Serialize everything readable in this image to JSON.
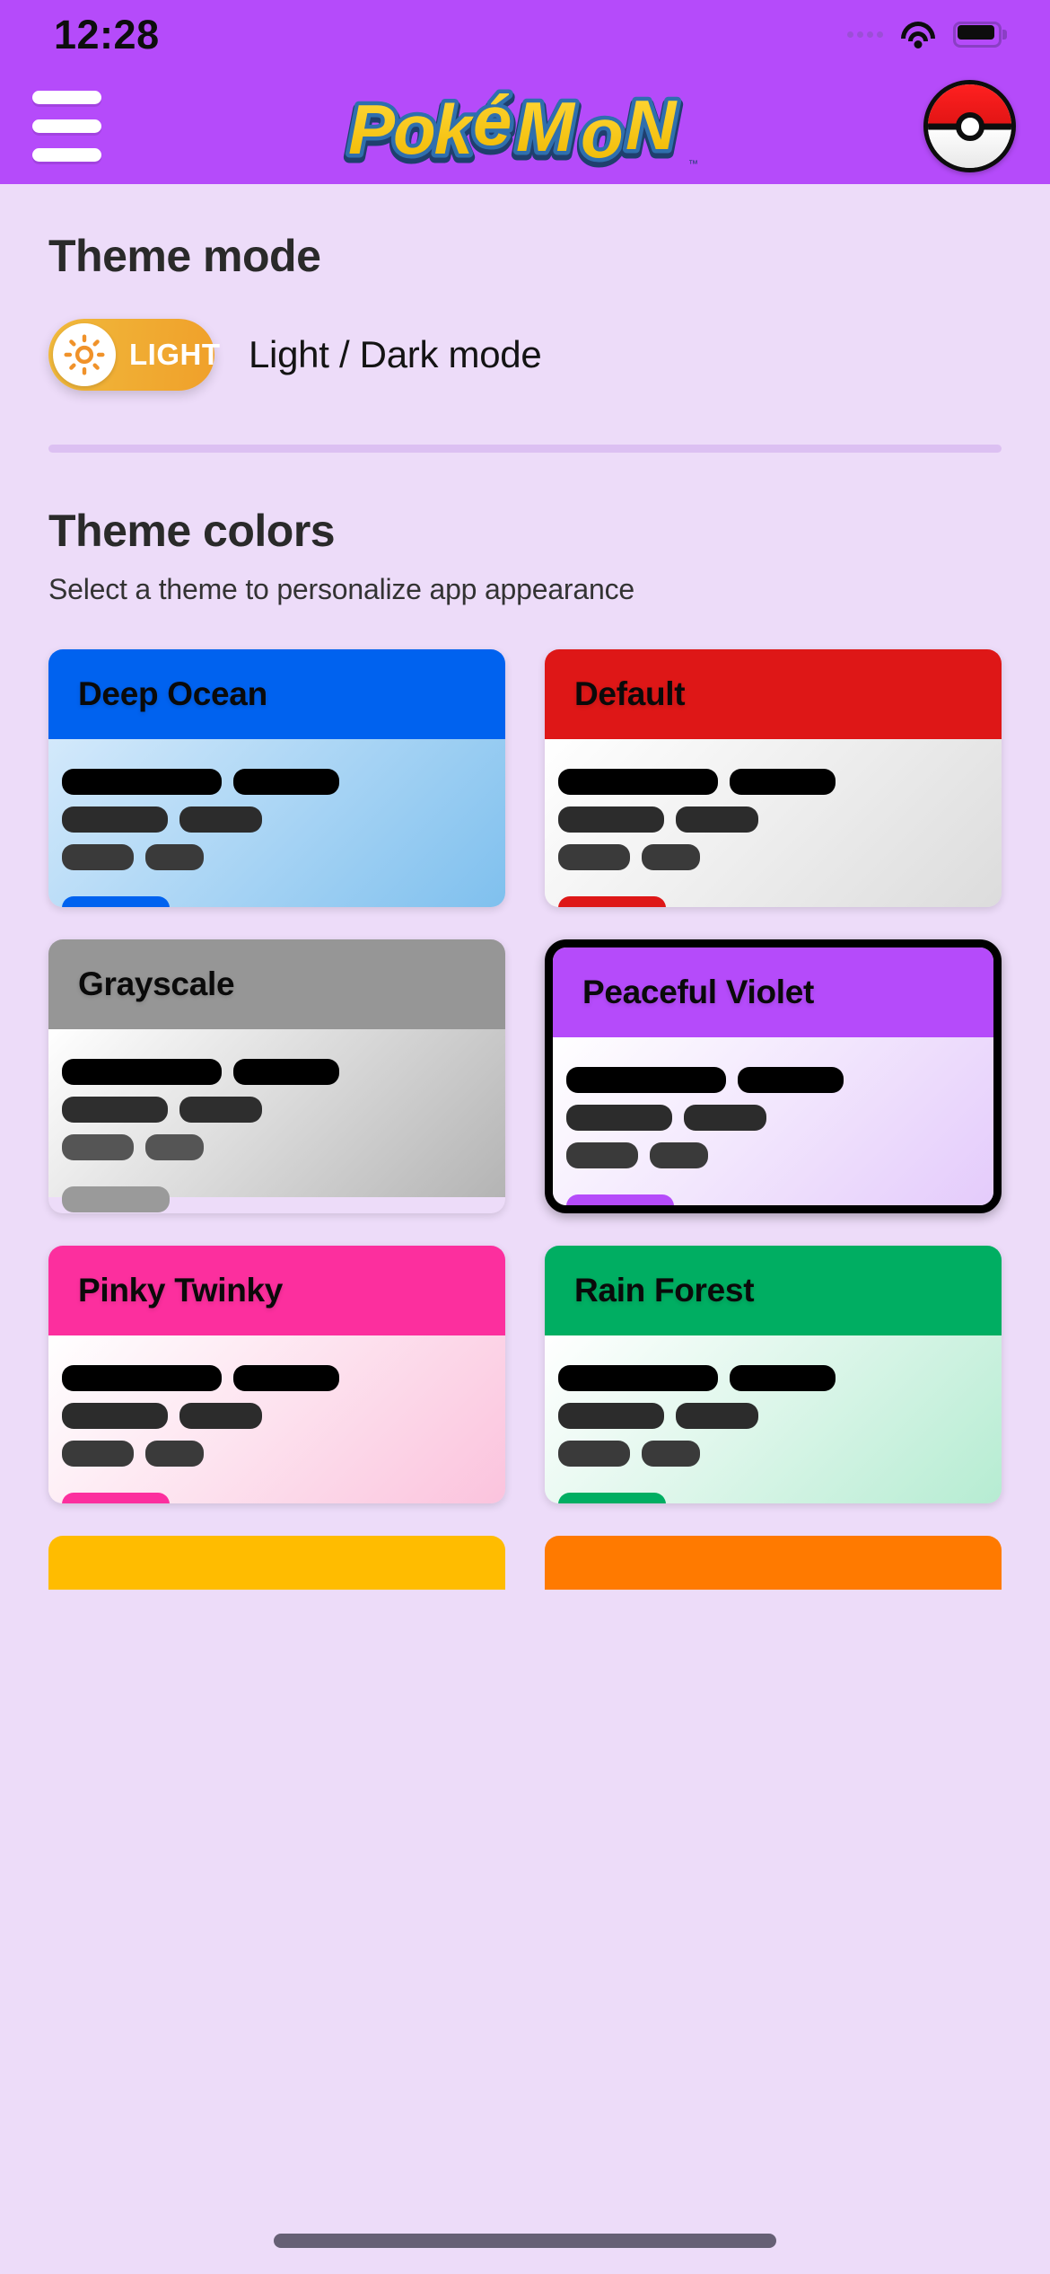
{
  "status_bar": {
    "time": "12:28",
    "icons": [
      "signal-dots-icon",
      "wifi-icon",
      "battery-icon"
    ]
  },
  "header": {
    "menu_icon": "hamburger-menu-icon",
    "logo_text": "Pokémon",
    "logo_tm": "TM",
    "profile_icon": "pokeball-icon",
    "background_color": "#b54bfa"
  },
  "theme_mode": {
    "title": "Theme mode",
    "toggle_label": "LIGHT",
    "toggle_icon": "sun-icon",
    "description": "Light / Dark mode",
    "toggle_color": "#f0a82f",
    "state": "light"
  },
  "theme_colors": {
    "title": "Theme colors",
    "subtitle": "Select a theme to personalize app appearance",
    "selected": "Peaceful Violet",
    "items": [
      {
        "name": "Deep Ocean",
        "header_color": "#0062ef",
        "body_from": "#d3e9fb",
        "body_to": "#7fc0ee",
        "accent_color": "#0062ef",
        "selected": false
      },
      {
        "name": "Default",
        "header_color": "#de1717",
        "body_from": "#ffffff",
        "body_to": "#dcdcdc",
        "accent_color": "#de1717",
        "selected": false
      },
      {
        "name": "Grayscale",
        "header_color": "#969696",
        "body_from": "#ffffff",
        "body_to": "#b4b4b4",
        "accent_color": "#9a9a9a",
        "selected": false
      },
      {
        "name": "Peaceful Violet",
        "header_color": "#b54bfa",
        "body_from": "#ffffff",
        "body_to": "#e4cbfb",
        "accent_color": "#b54bfa",
        "selected": true
      },
      {
        "name": "Pinky Twinky",
        "header_color": "#fc2f9e",
        "body_from": "#ffffff",
        "body_to": "#fbc3dd",
        "accent_color": "#fc2f9e",
        "selected": false
      },
      {
        "name": "Rain Forest",
        "header_color": "#00ae62",
        "body_from": "#ffffff",
        "body_to": "#b6ecd2",
        "accent_color": "#00ae62",
        "selected": false
      }
    ],
    "partial_items": [
      {
        "header_color": "#ffbc00"
      },
      {
        "header_color": "#ff7a00"
      }
    ]
  },
  "page_background": "#eddcf9"
}
